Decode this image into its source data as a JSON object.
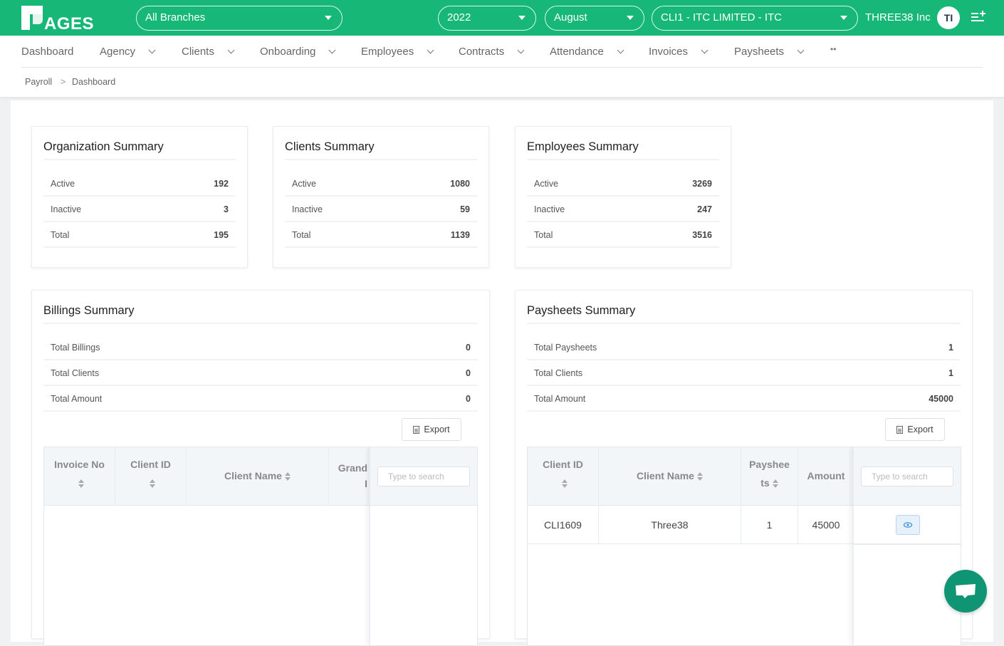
{
  "header": {
    "logo_text": "AGES",
    "branch_select": "All Branches",
    "year_select": "2022",
    "month_select": "August",
    "client_select": "CLI1 - ITC LIMITED - ITC",
    "org_name": "THREE38 Inc",
    "avatar_initials": "TI",
    "brand_color": "#17b877"
  },
  "nav": {
    "items": [
      {
        "label": "Dashboard",
        "dropdown": false
      },
      {
        "label": "Agency",
        "dropdown": true
      },
      {
        "label": "Clients",
        "dropdown": true
      },
      {
        "label": "Onboarding",
        "dropdown": true
      },
      {
        "label": "Employees",
        "dropdown": true
      },
      {
        "label": "Contracts",
        "dropdown": true
      },
      {
        "label": "Attendance",
        "dropdown": true
      },
      {
        "label": "Invoices",
        "dropdown": true
      },
      {
        "label": "Paysheets",
        "dropdown": true
      }
    ],
    "more_label": "••"
  },
  "breadcrumb": {
    "items": [
      "Payroll",
      "Dashboard"
    ],
    "separator": ">"
  },
  "cards": {
    "organization": {
      "title": "Organization Summary",
      "rows": [
        {
          "label": "Active",
          "value": "192"
        },
        {
          "label": "Inactive",
          "value": "3"
        },
        {
          "label": "Total",
          "value": "195"
        }
      ]
    },
    "clients": {
      "title": "Clients Summary",
      "rows": [
        {
          "label": "Active",
          "value": "1080"
        },
        {
          "label": "Inactive",
          "value": "59"
        },
        {
          "label": "Total",
          "value": "1139"
        }
      ]
    },
    "employees": {
      "title": "Employees Summary",
      "rows": [
        {
          "label": "Active",
          "value": "3269"
        },
        {
          "label": "Inactive",
          "value": "247"
        },
        {
          "label": "Total",
          "value": "3516"
        }
      ]
    },
    "billings": {
      "title": "Billings Summary",
      "rows": [
        {
          "label": "Total Billings",
          "value": "0"
        },
        {
          "label": "Total Clients",
          "value": "0"
        },
        {
          "label": "Total Amount",
          "value": "0"
        }
      ],
      "export_label": "Export",
      "table": {
        "columns": [
          "Invoice No",
          "Client ID",
          "Client Name",
          "Grand",
          "I"
        ],
        "search_placeholder": "Type to search",
        "rows": []
      }
    },
    "paysheets": {
      "title": "Paysheets Summary",
      "rows": [
        {
          "label": "Total Paysheets",
          "value": "1"
        },
        {
          "label": "Total Clients",
          "value": "1"
        },
        {
          "label": "Total Amount",
          "value": "45000"
        }
      ],
      "export_label": "Export",
      "table": {
        "columns": [
          "Client ID",
          "Client Name",
          "Payshee",
          "ts",
          "Amount"
        ],
        "search_placeholder": "Type to search",
        "rows": [
          {
            "client_id": "CLI1609",
            "client_name": "Three38",
            "paysheets": "1",
            "amount": "45000"
          }
        ]
      }
    }
  }
}
